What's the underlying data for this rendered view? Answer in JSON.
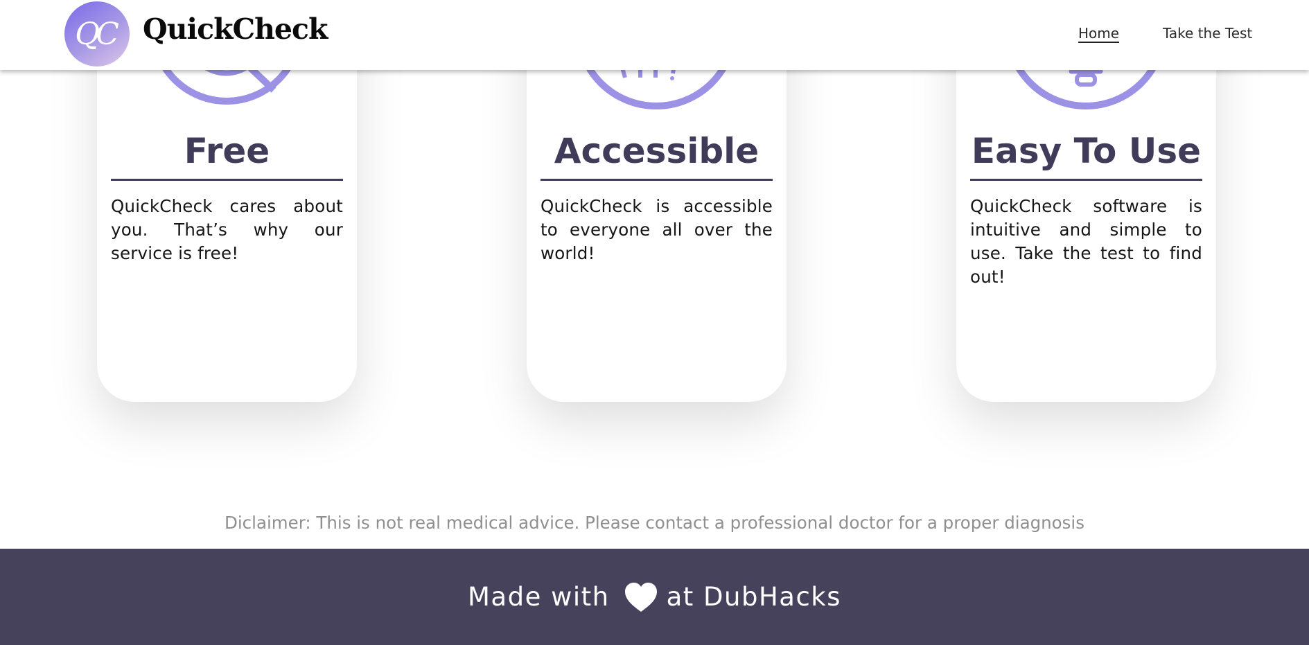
{
  "header": {
    "logo_text": "QC",
    "brand": "QuickCheck",
    "nav": [
      {
        "label": "Home"
      },
      {
        "label": "Take the Test"
      }
    ]
  },
  "features": [
    {
      "icon": "no-sign-icon",
      "title": "Free",
      "text": "QuickCheck cares about you. That’s why our service is free!"
    },
    {
      "icon": "globe-icon",
      "title": "Accessible",
      "text": "QuickCheck is accessible to everyone all over the world!"
    },
    {
      "icon": "lightbulb-icon",
      "title": "Easy To Use",
      "text": "QuickCheck software is intuitive and simple to use. Take the test to find out!"
    }
  ],
  "disclaimer": "Diclaimer: This is not real medical advice. Please contact a professional doctor for a proper diagnosis",
  "footer": {
    "before": "Made with",
    "icon": "heart-icon",
    "after": "at DubHacks"
  },
  "colors": {
    "accent": "#9b92e6",
    "heading": "#3f3b59",
    "footer_bg": "#47425c",
    "disclaimer": "#8f8f8f"
  }
}
